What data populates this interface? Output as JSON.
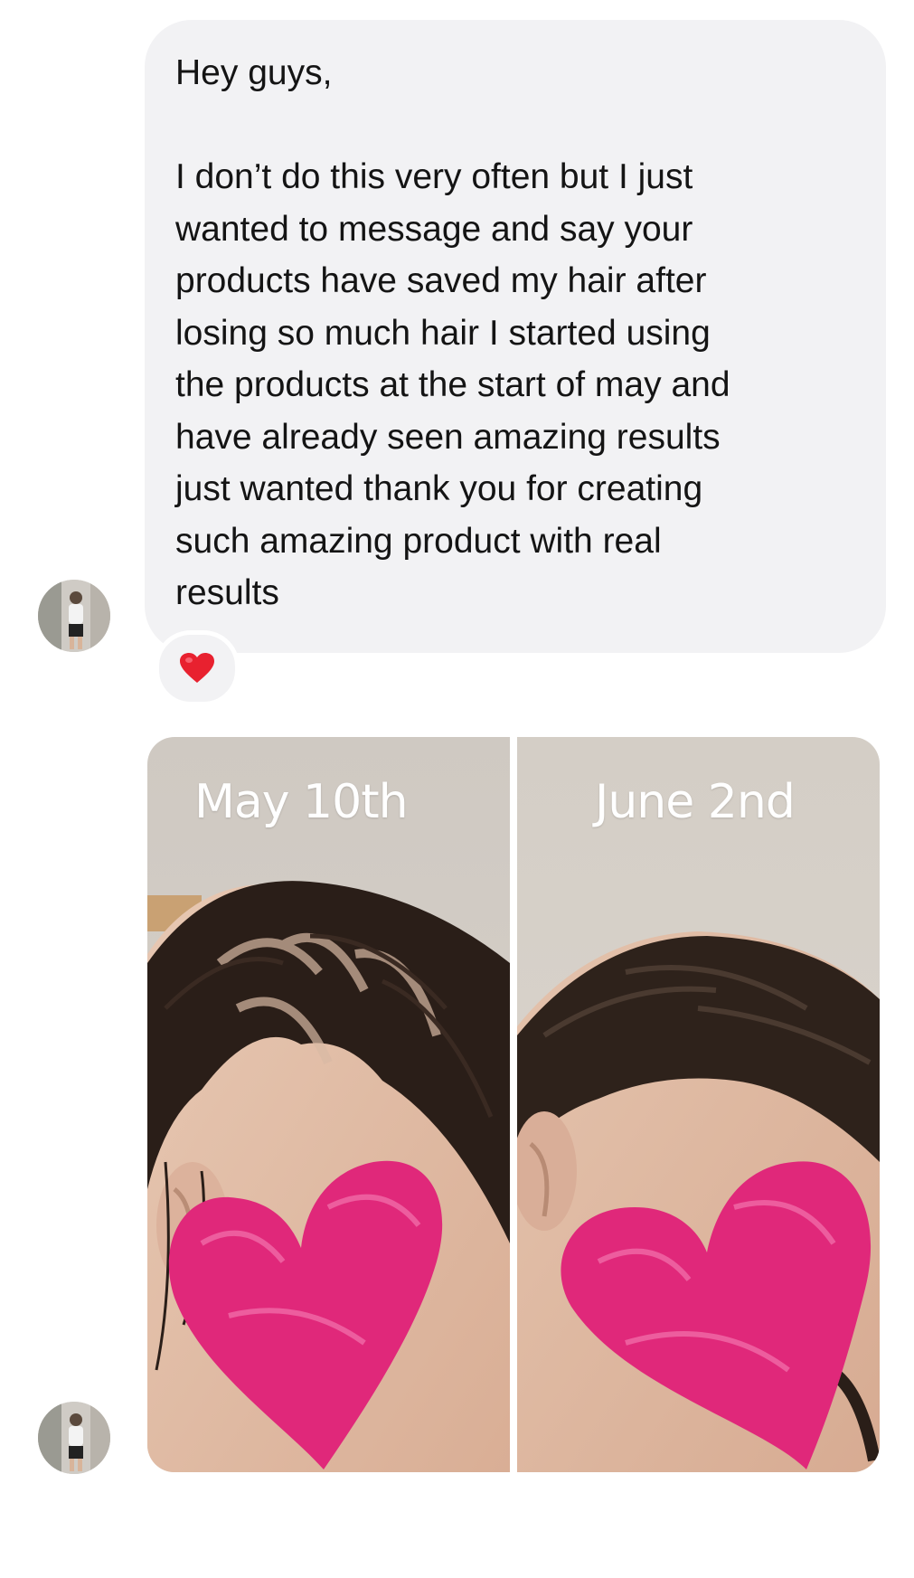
{
  "message": {
    "greeting": "Hey guys,",
    "body": "I don’t do this very often but I just\nwanted to message and say your\nproducts have saved my hair after\nlosing so much hair I started using\nthe products at the start of may and\nhave already seen amazing results\njust wanted thank you for creating\nsuch amazing product with real\nresults",
    "reaction": "❤️",
    "bubble_color": "#f2f2f4"
  },
  "photo": {
    "before_label": "May 10th",
    "after_label": "June 2nd"
  },
  "colors": {
    "heart_sticker": "#e0287a",
    "reaction_heart": "#e8212f"
  }
}
